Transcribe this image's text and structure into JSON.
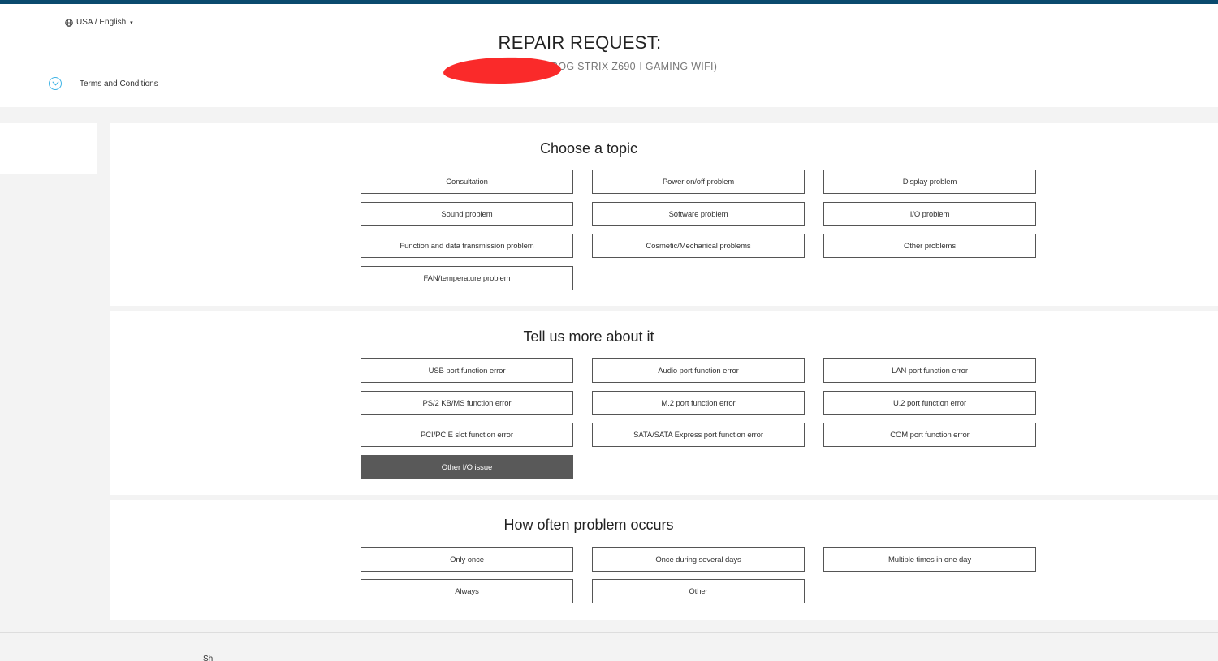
{
  "header": {
    "locale": "USA / English",
    "title": "REPAIR REQUEST:",
    "subtitle": "ROG STRIX Z690-I GAMING WIFI)",
    "terms": "Terms and Conditions"
  },
  "sections": [
    {
      "title": "Choose a topic",
      "options": [
        "Consultation",
        "Power on/off problem",
        "Display problem",
        "Sound problem",
        "Software problem",
        "I/O problem",
        "Function and data transmission problem",
        "Cosmetic/Mechanical problems",
        "Other problems",
        "FAN/temperature problem"
      ]
    },
    {
      "title": "Tell us more about it",
      "options": [
        "USB port function error",
        "Audio port function error",
        "LAN port function error",
        "PS/2 KB/MS function error",
        "M.2 port function error",
        "U.2 port function error",
        "PCI/PCIE slot function error",
        "SATA/SATA Express port function error",
        "COM port function error",
        "Other I/O issue"
      ],
      "selected": "Other I/O issue"
    },
    {
      "title": "How often problem occurs",
      "options": [
        "Only once",
        "Once during several days",
        "Multiple times in one day",
        "Always",
        "Other"
      ]
    }
  ],
  "footer": {
    "partial_text": "Sh"
  },
  "colors": {
    "top_bar": "#0a4a6e",
    "selected_option": "#595959",
    "terms_icon": "#3fb4e6",
    "redaction": "#fa2a2a"
  }
}
